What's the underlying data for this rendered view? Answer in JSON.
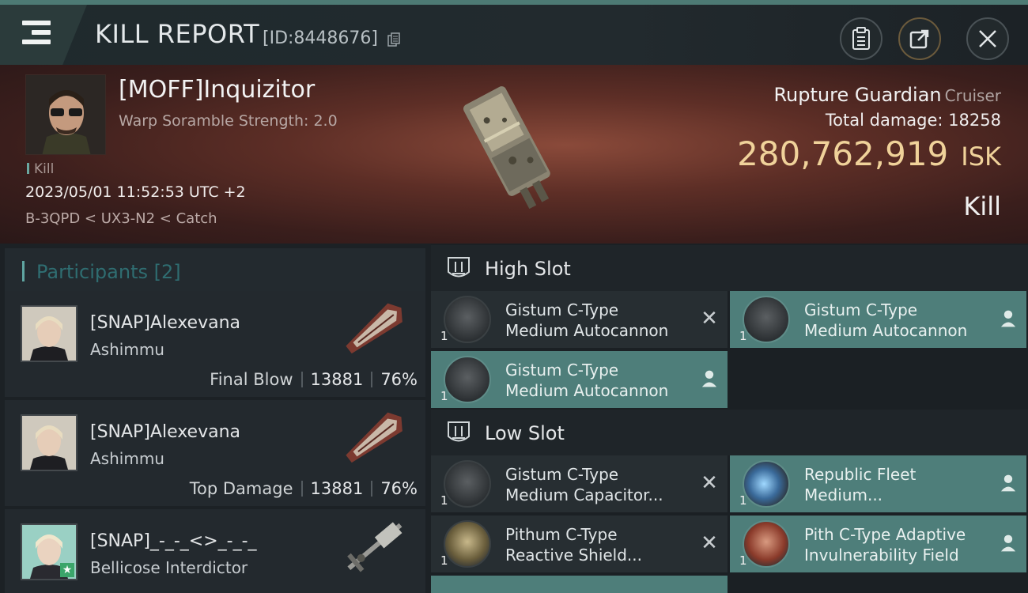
{
  "header": {
    "title": "KILL REPORT",
    "report_id": "[ID:8448676]"
  },
  "victim": {
    "name": "[MOFF]Inquizitor",
    "subtitle": "Warp Soramble Strength: 2.0",
    "kill_tag": "Kill",
    "datetime": "2023/05/01 11:52:53 UTC +2",
    "route": "B-3QPD < UX3-N2 < Catch",
    "ship_name": "Rupture Guardian",
    "ship_class": "Cruiser",
    "total_damage_label": "Total damage:",
    "total_damage": "18258",
    "isk_value": "280,762,919",
    "isk_unit": "ISK",
    "result": "Kill"
  },
  "participants": {
    "label": "Participants",
    "count": "[2]",
    "rows": [
      {
        "name": "[SNAP]Alexevana",
        "ship": "Ashimmu",
        "role": "Final Blow",
        "damage": "13881",
        "percent": "76%"
      },
      {
        "name": "[SNAP]Alexevana",
        "ship": "Ashimmu",
        "role": "Top Damage",
        "damage": "13881",
        "percent": "76%"
      },
      {
        "name": "[SNAP]_-_-_<>_-_-_",
        "ship": "Bellicose Interdictor"
      }
    ]
  },
  "fitting": {
    "high_slot_label": "High Slot",
    "low_slot_label": "Low Slot",
    "high": [
      {
        "qty": "1",
        "line1": "Gistum C-Type",
        "line2": "Medium Autocannon",
        "status": "destroyed"
      },
      {
        "qty": "1",
        "line1": "Gistum C-Type",
        "line2": "Medium Autocannon",
        "status": "dropped"
      },
      {
        "qty": "1",
        "line1": "Gistum C-Type",
        "line2": "Medium Autocannon",
        "status": "dropped"
      }
    ],
    "low": [
      {
        "qty": "1",
        "line1": "Gistum C-Type",
        "line2": "Medium Capacitor...",
        "status": "destroyed"
      },
      {
        "qty": "1",
        "line1": "Republic Fleet",
        "line2": "Medium...",
        "status": "dropped"
      },
      {
        "qty": "1",
        "line1": "Pithum C-Type",
        "line2": "Reactive Shield...",
        "status": "destroyed"
      },
      {
        "qty": "1",
        "line1": "Pith C-Type Adaptive",
        "line2": "Invulnerability Field",
        "status": "dropped"
      }
    ]
  }
}
